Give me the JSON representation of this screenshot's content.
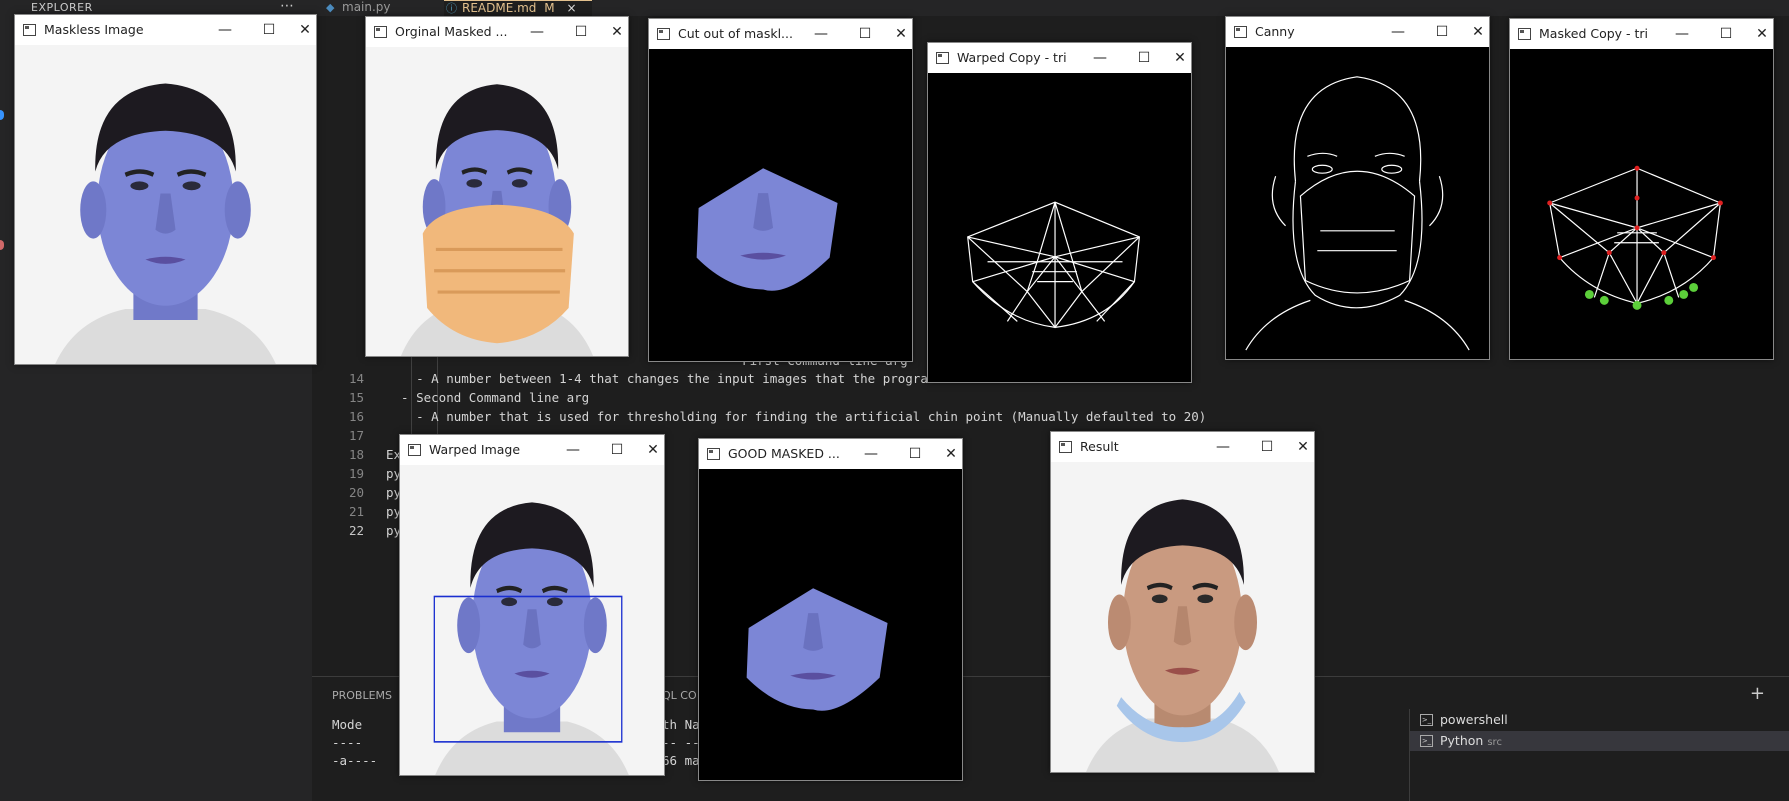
{
  "vscode": {
    "explorer_title": "EXPLORER",
    "tabs": [
      {
        "label": "main.py",
        "icon": "python-icon"
      },
      {
        "label": "README.md",
        "badge": "M",
        "icon": "markdown-icon",
        "close": "×"
      }
    ],
    "code_lines": [
      {
        "n": "14",
        "text": "    - A number between 1-4 that changes the input images that the program uses"
      },
      {
        "n": "15",
        "text": "  - Second Command line arg"
      },
      {
        "n": "16",
        "text": "    - A number that is used for thresholding for finding the artificial chin point (Manually defaulted to 20)"
      },
      {
        "n": "17",
        "text": ""
      },
      {
        "n": "18",
        "text": "Exa"
      },
      {
        "n": "19",
        "text": "pyt"
      },
      {
        "n": "20",
        "text": "pyt"
      },
      {
        "n": "21",
        "text": "pyt"
      },
      {
        "n": "22",
        "text": "pyt"
      }
    ],
    "line13_fragment": "  - First Command line arg",
    "panel_tab": "PROBLEMS",
    "panel_tab2": "QL CO",
    "terminal": {
      "lines": [
        "Mode",
        "----",
        "-a----"
      ],
      "cols": [
        "th Nam",
        "-- ---",
        "66 mai"
      ]
    },
    "terminal_list": [
      {
        "label": "powershell",
        "sub": "",
        "icon": "terminal-icon"
      },
      {
        "label": "Python",
        "sub": "src",
        "icon": "terminal-icon"
      }
    ],
    "plus": "+"
  },
  "windows": [
    {
      "id": "maskless",
      "title": "Maskless Image",
      "kind": "face-blue"
    },
    {
      "id": "original-masked",
      "title": "Orginal Masked ...",
      "kind": "face-masked"
    },
    {
      "id": "cutout",
      "title": "Cut out of maskl...",
      "kind": "cutout"
    },
    {
      "id": "warped-copy",
      "title": "Warped Copy - tri",
      "kind": "tri-mesh"
    },
    {
      "id": "canny",
      "title": "Canny",
      "kind": "canny"
    },
    {
      "id": "masked-copy",
      "title": "Masked Copy - tri",
      "kind": "tri-points"
    },
    {
      "id": "warped-image",
      "title": "Warped Image",
      "kind": "face-box"
    },
    {
      "id": "good-masked",
      "title": "GOOD MASKED ...",
      "kind": "cutout-2"
    },
    {
      "id": "result",
      "title": "Result",
      "kind": "face-result"
    }
  ],
  "controls": {
    "minimize": "—",
    "maximize": "☐",
    "close": "✕"
  },
  "colors": {
    "face_blue": "#7c86d6",
    "hair": "#1d1a20",
    "mask": "#f1b87b",
    "result_skin": "#c99a80",
    "point_red": "#e02020",
    "point_green": "#5ccf3a"
  }
}
